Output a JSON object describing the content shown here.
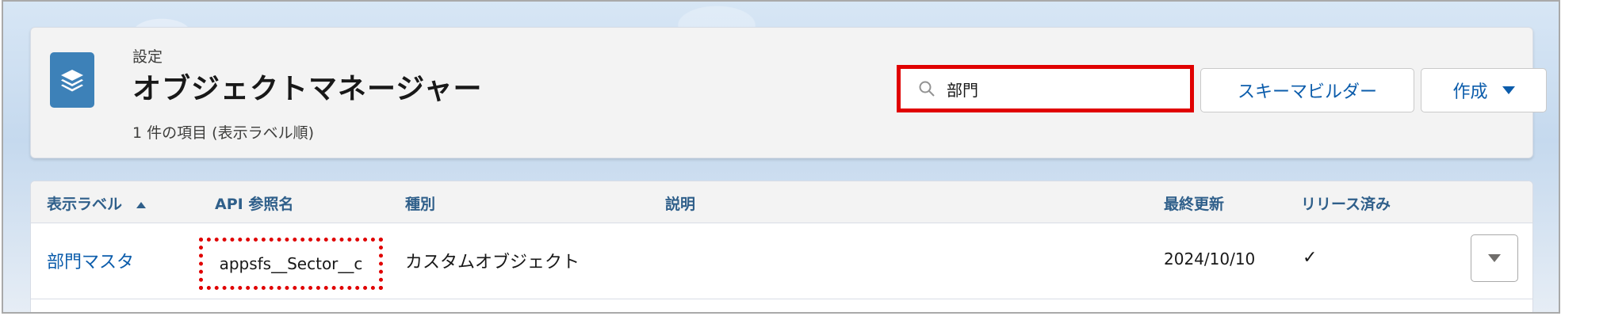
{
  "header": {
    "breadcrumb": "設定",
    "title": "オブジェクトマネージャー",
    "item_count": "1 件の項目 (表示ラベル順)",
    "icon": "layers-icon",
    "search": {
      "value": "部門",
      "icon": "search-icon"
    },
    "schema_builder_label": "スキーマビルダー",
    "new_label": "作成"
  },
  "table": {
    "columns": [
      "表示ラベル",
      "API 参照名",
      "種別",
      "説明",
      "最終更新",
      "リリース済み"
    ],
    "sort_icon": "sort-ascending-icon",
    "rows": [
      {
        "label": "部門マスタ",
        "api_name": "appsfs__Sector__c",
        "type": "カスタムオブジェクト",
        "description": "",
        "last_modified": "2024/10/10",
        "deployed": "✓",
        "menu_icon": "chevron-down-icon"
      }
    ]
  },
  "colors": {
    "accent": "#0b5cab",
    "icon_bg": "#3d81b8",
    "highlight": "#e00000"
  }
}
